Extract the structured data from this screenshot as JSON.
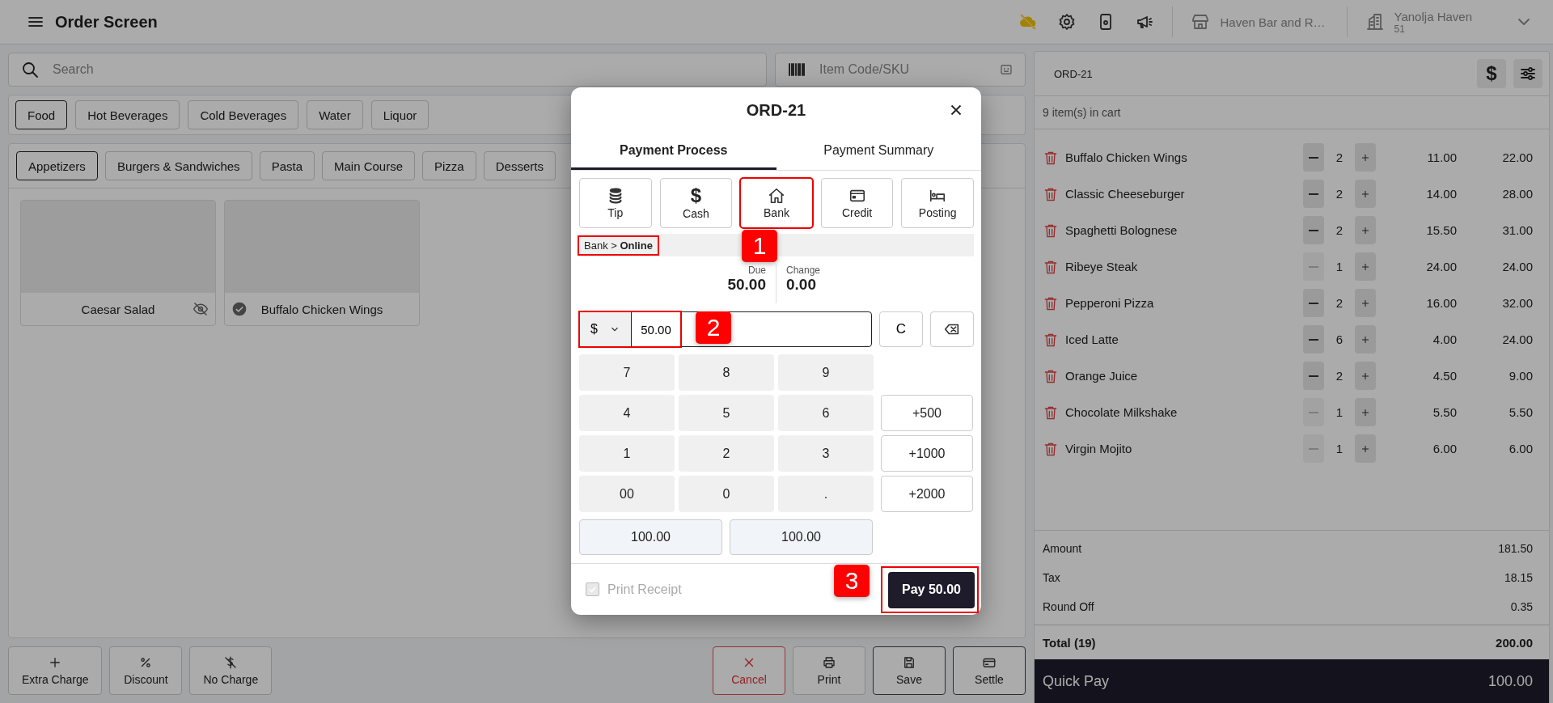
{
  "top_bar": {
    "title": "Order Screen",
    "store": "Haven Bar and R…",
    "user": {
      "name": "Yanolja Haven",
      "number": "51"
    }
  },
  "search": {
    "placeholder": "Search"
  },
  "sku_field": {
    "placeholder": "Item Code/SKU"
  },
  "categories": [
    {
      "label": "Food",
      "selected": true
    },
    {
      "label": "Hot Beverages",
      "selected": false
    },
    {
      "label": "Cold Beverages",
      "selected": false
    },
    {
      "label": "Water",
      "selected": false
    },
    {
      "label": "Liquor",
      "selected": false
    }
  ],
  "subcategories": [
    {
      "label": "Appetizers",
      "selected": true
    },
    {
      "label": "Burgers & Sandwiches",
      "selected": false
    },
    {
      "label": "Pasta",
      "selected": false
    },
    {
      "label": "Main Course",
      "selected": false
    },
    {
      "label": "Pizza",
      "selected": false
    },
    {
      "label": "Desserts",
      "selected": false
    }
  ],
  "products": [
    {
      "name": "Caesar Salad",
      "hidden": true,
      "in_cart": false
    },
    {
      "name": "Buffalo Chicken Wings",
      "hidden": false,
      "in_cart": true
    }
  ],
  "actions_left": [
    {
      "kind": "extra-charge",
      "label": "Extra Charge"
    },
    {
      "kind": "discount",
      "label": "Discount"
    },
    {
      "kind": "no-charge",
      "label": "No Charge"
    }
  ],
  "actions_right": [
    {
      "kind": "cancel",
      "label": "Cancel"
    },
    {
      "kind": "print",
      "label": "Print"
    },
    {
      "kind": "save",
      "label": "Save"
    },
    {
      "kind": "settle",
      "label": "Settle"
    }
  ],
  "cart": {
    "order": "ORD-21",
    "currency_button": "$",
    "count": "9 item(s) in cart",
    "items": [
      {
        "name": "Buffalo Chicken Wings",
        "qty": "2",
        "minus_disabled": false,
        "price": "11.00",
        "total": "22.00"
      },
      {
        "name": "Classic Cheeseburger",
        "qty": "2",
        "minus_disabled": false,
        "price": "14.00",
        "total": "28.00"
      },
      {
        "name": "Spaghetti Bolognese",
        "qty": "2",
        "minus_disabled": false,
        "price": "15.50",
        "total": "31.00"
      },
      {
        "name": "Ribeye Steak",
        "qty": "1",
        "minus_disabled": true,
        "price": "24.00",
        "total": "24.00"
      },
      {
        "name": "Pepperoni Pizza",
        "qty": "2",
        "minus_disabled": false,
        "price": "16.00",
        "total": "32.00"
      },
      {
        "name": "Iced Latte",
        "qty": "6",
        "minus_disabled": false,
        "price": "4.00",
        "total": "24.00"
      },
      {
        "name": "Orange Juice",
        "qty": "2",
        "minus_disabled": false,
        "price": "4.50",
        "total": "9.00"
      },
      {
        "name": "Chocolate Milkshake",
        "qty": "1",
        "minus_disabled": true,
        "price": "5.50",
        "total": "5.50"
      },
      {
        "name": "Virgin Mojito",
        "qty": "1",
        "minus_disabled": true,
        "price": "6.00",
        "total": "6.00"
      }
    ],
    "summary": [
      {
        "label": "Amount",
        "value": "181.50"
      },
      {
        "label": "Tax",
        "value": "18.15"
      },
      {
        "label": "Round Off",
        "value": "0.35"
      }
    ],
    "total": {
      "label": "Total (19)",
      "value": "200.00"
    },
    "quick_pay": {
      "label": "Quick Pay",
      "value": "100.00"
    }
  },
  "modal": {
    "title": "ORD-21",
    "tabs": [
      {
        "label": "Payment Process",
        "selected": true
      },
      {
        "label": "Payment Summary",
        "selected": false
      }
    ],
    "methods": [
      {
        "kind": "tip",
        "label": "Tip",
        "highlighted": false
      },
      {
        "kind": "cash",
        "label": "Cash",
        "symbol": "$",
        "highlighted": false
      },
      {
        "kind": "bank",
        "label": "Bank",
        "highlighted": true
      },
      {
        "kind": "credit",
        "label": "Credit",
        "highlighted": false
      },
      {
        "kind": "posting",
        "label": "Posting",
        "highlighted": false
      }
    ],
    "breadcrumb": {
      "text": "Bank > **Online**",
      "highlighted": true
    },
    "due": {
      "label": "Due",
      "value": "50.00"
    },
    "change": {
      "label": "Change",
      "value": "0.00"
    },
    "amount_input": {
      "currency": "$",
      "value": "50.00",
      "highlighted": true
    },
    "clear_key": "C",
    "keys": [
      "7",
      "8",
      "9",
      "4",
      "5",
      "6",
      "1",
      "2",
      "3",
      "00",
      "0",
      "."
    ],
    "quick_adds": [
      "+500",
      "+1000",
      "+2000"
    ],
    "suggestions": [
      "100.00",
      "100.00"
    ],
    "print_receipt": {
      "label": "Print Receipt",
      "checked": true,
      "disabled": true
    },
    "pay_button": {
      "label": "Pay 50.00",
      "highlighted": true
    }
  },
  "step_badges": [
    "1",
    "2",
    "3"
  ]
}
